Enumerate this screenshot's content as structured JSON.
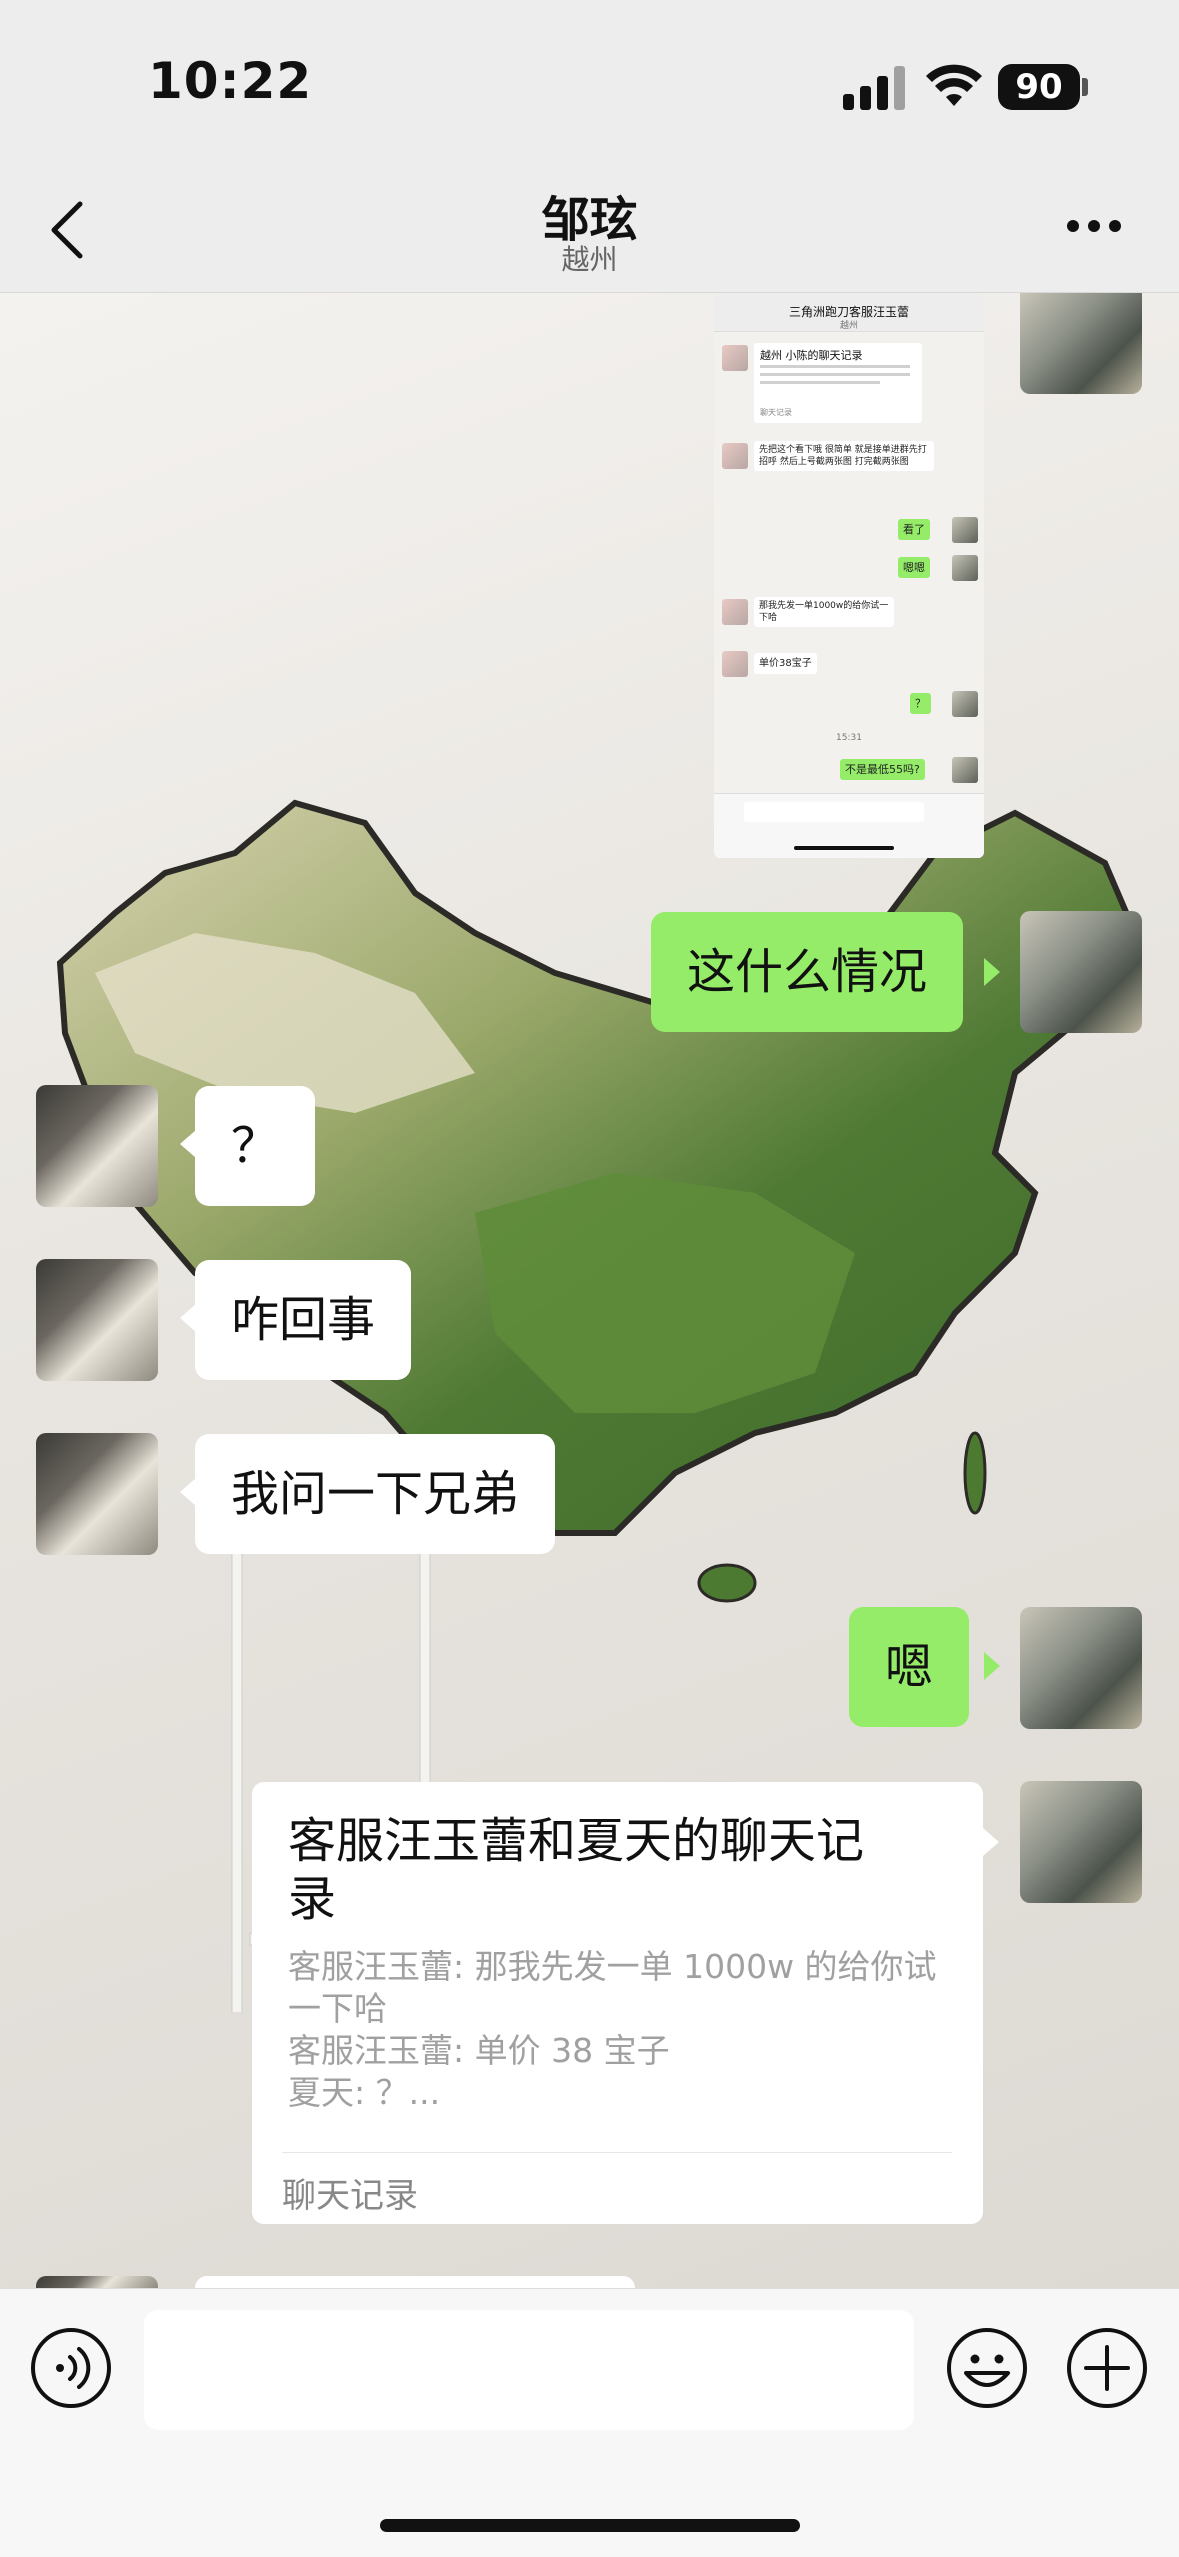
{
  "status": {
    "time": "10:22",
    "battery": "90"
  },
  "nav": {
    "title": "邹玹",
    "subtitle": "越州"
  },
  "messages": {
    "m1": "这什么情况",
    "m2": "？",
    "m3": "咋回事",
    "m4": "我问一下兄弟",
    "m5": "嗯"
  },
  "screenshot": {
    "title": "三角洲跑刀客服汪玉蕾",
    "subtitle": "越州",
    "card_title": "越州 小陈的聊天记录",
    "card_footer": "聊天记录",
    "msg1": "先把这个看下哦 很简单 就是接单进群先打招呼 然后上号截两张图 打完截两张图",
    "msg2": "看了",
    "msg3": "嗯嗯",
    "msg4": "那我先发一单1000w的给你试一下哈",
    "msg5": "单价38宝子",
    "msg6": "？",
    "time": "15:31",
    "msg7": "不是最低55吗?"
  },
  "record": {
    "title": "客服汪玉蕾和夏天的聊天记录",
    "line1": "客服汪玉蕾: 那我先发一单 1000w 的给你试一下哈",
    "line2": "客服汪玉蕾: 单价 38 宝子",
    "line3": "夏天: ？...",
    "footer": "聊天记录"
  },
  "input": {
    "value": ""
  },
  "colors": {
    "sent_bubble": "#95ec69",
    "received_bubble": "#ffffff",
    "background": "#ededed"
  },
  "icons": [
    "back-chevron-icon",
    "more-dots-icon",
    "voice-icon",
    "emoji-icon",
    "plus-icon",
    "wifi-icon",
    "signal-icon"
  ]
}
